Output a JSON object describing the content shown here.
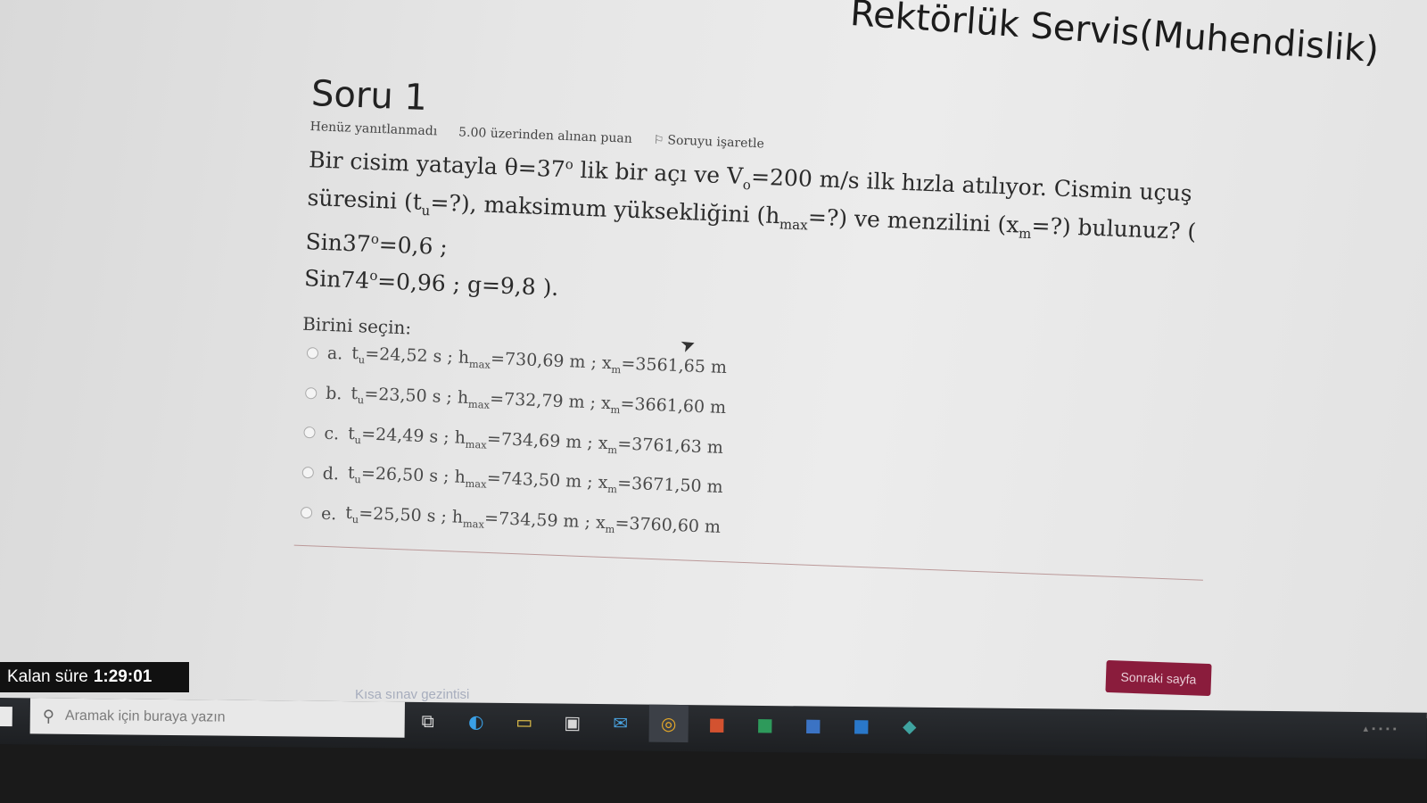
{
  "header": {
    "site_title": "Rektörlük Servis(Muhendislik)"
  },
  "question": {
    "title": "Soru 1",
    "status": "Henüz yanıtlanmadı",
    "points": "5.00 üzerinden alınan puan",
    "flag_label": "Soruyu işaretle",
    "text_part1": "Bir cisim yatayla  θ=37",
    "text_sup1": "o",
    "text_part2": " lik bir açı ve  V",
    "text_sub_v": "o",
    "text_part3": "=200 m/s ilk hızla atılıyor. Cismin uçuş süresini (t",
    "text_sub_u": "u",
    "text_part4": "=?), maksimum yüksekliğini (h",
    "text_sub_max": "max",
    "text_part5": "=?) ve menzilini (x",
    "text_sub_m": "m",
    "text_part6": "=?) bulunuz? ( Sin37",
    "text_sup2": "o",
    "text_part7": "=0,6 ;",
    "text_line3": "Sin74",
    "text_sup3": "o",
    "text_part8": "=0,96   ;   g=9,8 )."
  },
  "answers": {
    "prompt": "Birini seçin:",
    "options": [
      {
        "letter": "a.",
        "tu": "=24,52 s",
        "hmax": "=730,69 m",
        "xm": "=3561,65 m"
      },
      {
        "letter": "b.",
        "tu": "=23,50 s",
        "hmax": "=732,79 m",
        "xm": "=3661,60 m"
      },
      {
        "letter": "c.",
        "tu": "=24,49 s",
        "hmax": "=734,69 m",
        "xm": "=3761,63 m"
      },
      {
        "letter": "d.",
        "tu": "=26,50 s",
        "hmax": "=743,50 m",
        "xm": "=3671,50 m"
      },
      {
        "letter": "e.",
        "tu": "=25,50 s",
        "hmax": "=734,59 m",
        "xm": "=3760,60 m"
      }
    ],
    "sym": {
      "t": "t",
      "sub_u": "u",
      "h": "h",
      "sub_max": "max",
      "x": "x",
      "sub_m": "m",
      "sep": ";"
    }
  },
  "footer": {
    "timer_label": "Kalan süre",
    "timer_value": "1:29:01",
    "next_button": "Sonraki sayfa",
    "nav_link": "Kısa sınav gezintisi"
  },
  "taskbar": {
    "search_placeholder": "Aramak için buraya yazın",
    "icons": [
      "task-view-icon",
      "edge-icon",
      "file-explorer-icon",
      "store-icon",
      "mail-icon",
      "chrome-icon",
      "powerpoint-icon",
      "excel-icon",
      "word-icon",
      "outlook-icon",
      "app-icon"
    ]
  },
  "colors": {
    "accent": "#8a1c3c",
    "timer_bg": "#111111"
  }
}
